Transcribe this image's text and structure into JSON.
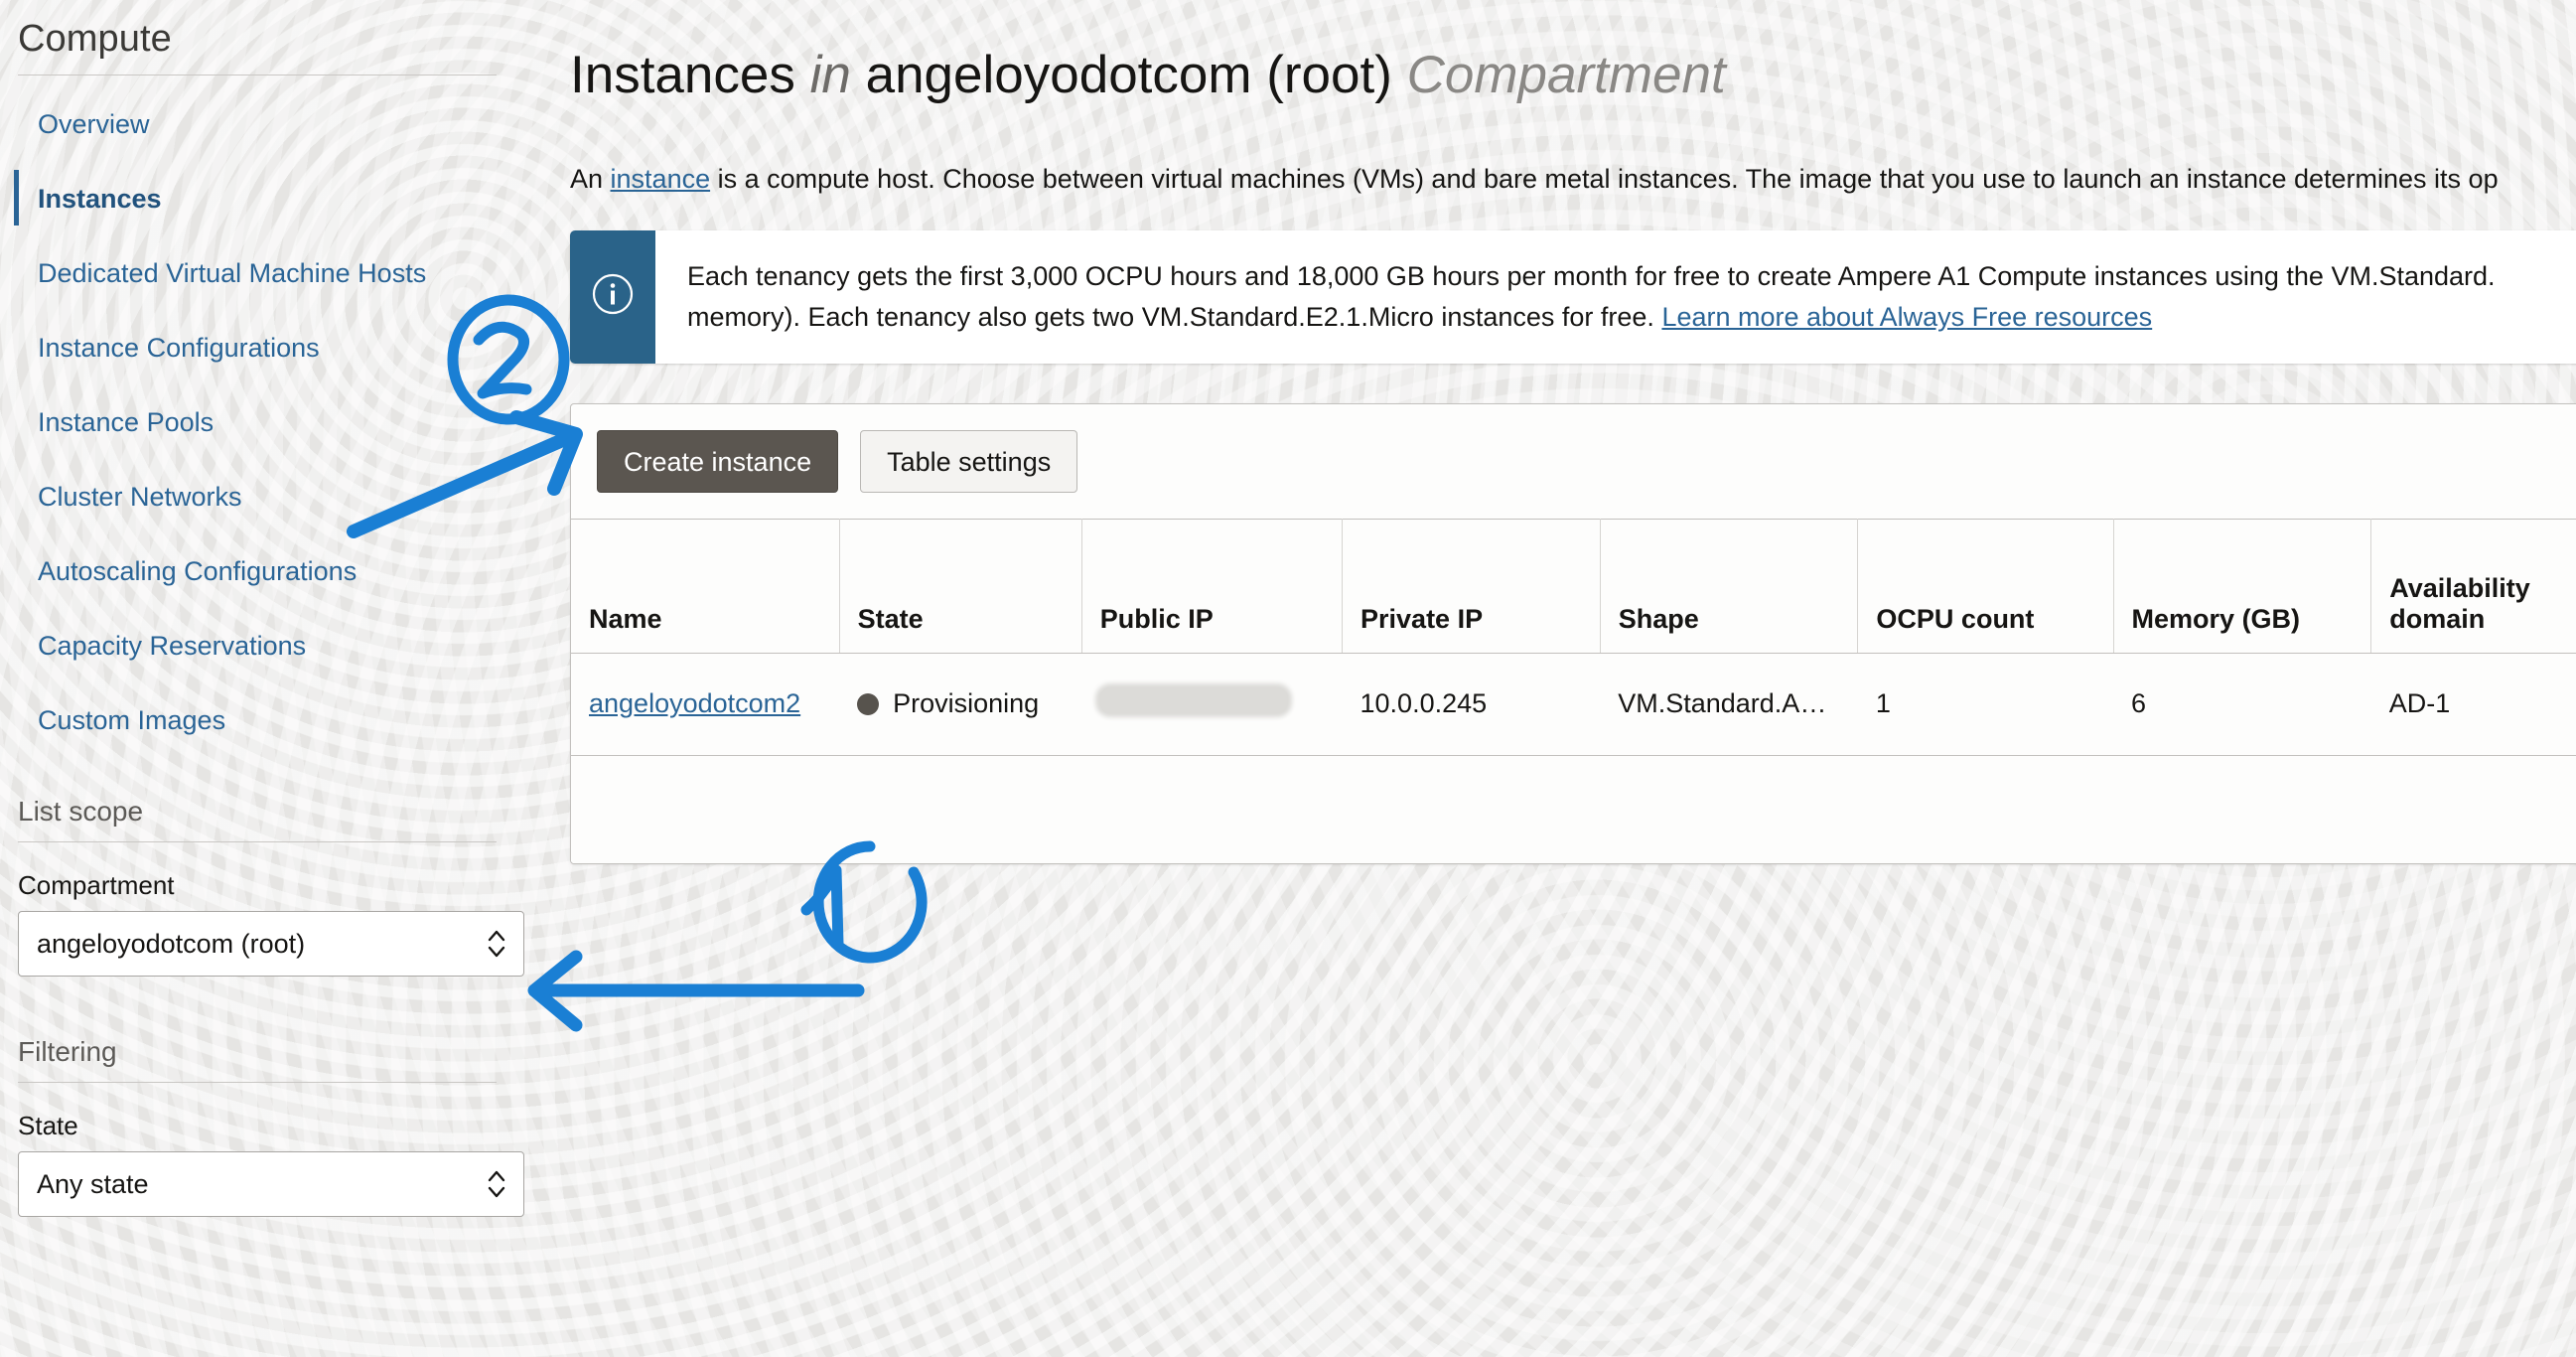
{
  "sidebar": {
    "heading": "Compute",
    "nav_items": [
      {
        "label": "Overview",
        "active": false
      },
      {
        "label": "Instances",
        "active": true
      },
      {
        "label": "Dedicated Virtual Machine Hosts",
        "active": false
      },
      {
        "label": "Instance Configurations",
        "active": false
      },
      {
        "label": "Instance Pools",
        "active": false
      },
      {
        "label": "Cluster Networks",
        "active": false
      },
      {
        "label": "Autoscaling Configurations",
        "active": false
      },
      {
        "label": "Capacity Reservations",
        "active": false
      },
      {
        "label": "Custom Images",
        "active": false
      }
    ],
    "list_scope": {
      "section_title": "List scope",
      "compartment_label": "Compartment",
      "compartment_value": "angeloyodotcom (root)"
    },
    "filtering": {
      "section_title": "Filtering",
      "state_label": "State",
      "state_value": "Any state"
    }
  },
  "main": {
    "title": {
      "prefix": "Instances",
      "in_word": "in",
      "compartment": "angeloyodotcom (root)",
      "suffix": "Compartment"
    },
    "description": {
      "before_link": "An ",
      "link_text": "instance",
      "after_link": " is a compute host. Choose between virtual machines (VMs) and bare metal instances. The image that you use to launch an instance determines its op"
    },
    "info_banner": {
      "icon": "info-circle-icon",
      "line1": "Each tenancy gets the first 3,000 OCPU hours and 18,000 GB hours per month for free to create Ampere A1 Compute instances using the VM.Standard.",
      "line2_before_link": "memory). Each tenancy also gets two VM.Standard.E2.1.Micro instances for free. ",
      "line2_link": "Learn more about Always Free resources"
    },
    "toolbar": {
      "create_label": "Create instance",
      "table_settings_label": "Table settings"
    },
    "table": {
      "columns": [
        "Name",
        "State",
        "Public IP",
        "Private IP",
        "Shape",
        "OCPU count",
        "Memory (GB)",
        "Availability domain"
      ],
      "rows": [
        {
          "name": "angeloyodotcom2",
          "state": "Provisioning",
          "public_ip": "",
          "private_ip": "10.0.0.245",
          "shape": "VM.Standard.A…",
          "ocpu_count": "1",
          "memory_gb": "6",
          "availability_domain": "AD-1"
        }
      ]
    }
  },
  "annotations": [
    {
      "label": "2",
      "target": "create-instance-button"
    },
    {
      "label": "1",
      "target": "compartment-select"
    }
  ],
  "colors": {
    "page_background": "#ecebe9",
    "link_blue": "#2a6496",
    "banner_blue": "#2a6389",
    "annotation_blue": "#1a7fd4",
    "primary_button": "#5b5650",
    "state_dot": "#57534d"
  }
}
